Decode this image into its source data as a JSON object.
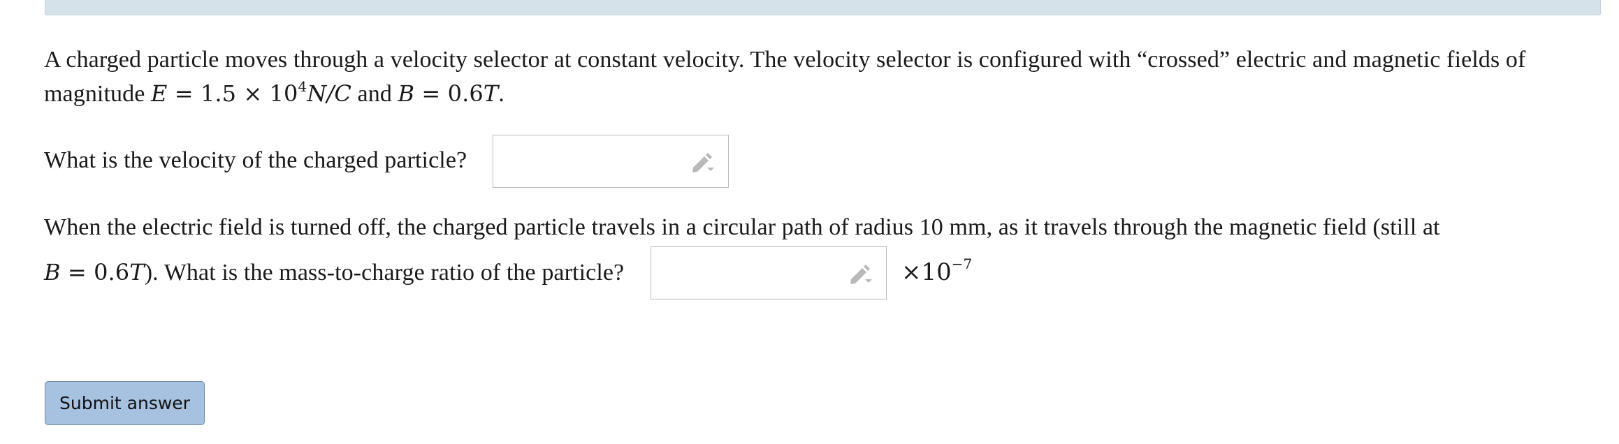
{
  "question": {
    "intro_line1": "A charged particle moves through a velocity selector at constant velocity. The velocity selector is configured with “crossed” electric and magnetic fields of",
    "intro_line2_prefix": "magnitude ",
    "E_expr": "E",
    "E_eq": " = 1.5 × 10",
    "E_exp": "4",
    "E_unit": "N/C",
    "and_text": " and ",
    "B_expr": "B",
    "B_eq": " = 0.6",
    "B_unit": "T",
    "period": ".",
    "part1_prompt": "What is the velocity of the charged particle?",
    "part2_line1": "When the electric field is turned off, the charged particle travels in a circular path of radius 10 mm, as it travels through the magnetic field (still at",
    "part2_B": "B",
    "part2_B_eq": " = 0.6",
    "part2_B_unit": "T",
    "part2_line2_rest": "). What is the mass-to-charge ratio of the particle?",
    "unit_multiplier": "×10",
    "unit_exp": "−7"
  },
  "answers": {
    "velocity_value": "",
    "mass_charge_value": ""
  },
  "icons": {
    "edit": "pencil-dropdown-icon"
  },
  "submit": {
    "label": "Submit answer"
  },
  "colors": {
    "banner": "#d6e2ea",
    "submit_bg": "#a7c1e0",
    "submit_border": "#6f8aa8"
  }
}
